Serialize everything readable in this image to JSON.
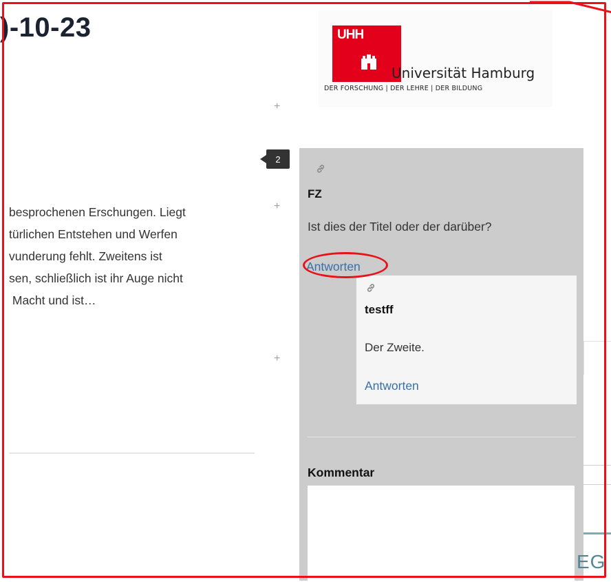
{
  "page": {
    "date_title": ")-10-23"
  },
  "logo": {
    "mark": "UHH",
    "name": "Universität Hamburg",
    "tagline": "DER FORSCHUNG | DER LEHRE | DER BILDUNG"
  },
  "badge": {
    "count": "2"
  },
  "plus_icon": "+",
  "article": {
    "lines": [
      "besprochenen Erschungen. Liegt",
      "türlichen Entstehen und Werfen",
      "vunderung fehlt. Zweitens ist",
      "sen, schließlich ist ihr Auge nicht",
      " Macht und ist…"
    ]
  },
  "comments": {
    "first": {
      "author": "FZ",
      "body": "Ist dies der Titel oder der darüber?",
      "reply_label": "Antworten"
    },
    "reply": {
      "author": "testff",
      "body": "Der Zweite.",
      "reply_label": "Antworten"
    }
  },
  "comment_form": {
    "label": "Kommentar",
    "value": ""
  },
  "right_edge": {
    "text": "EG"
  },
  "colors": {
    "annotation_red": "#e8121a",
    "uhh_red": "#e2001a",
    "link_blue": "#3a6fa6",
    "panel_gray": "#cccccc"
  },
  "icons": {
    "permalink": "link-icon",
    "add": "plus-icon"
  }
}
